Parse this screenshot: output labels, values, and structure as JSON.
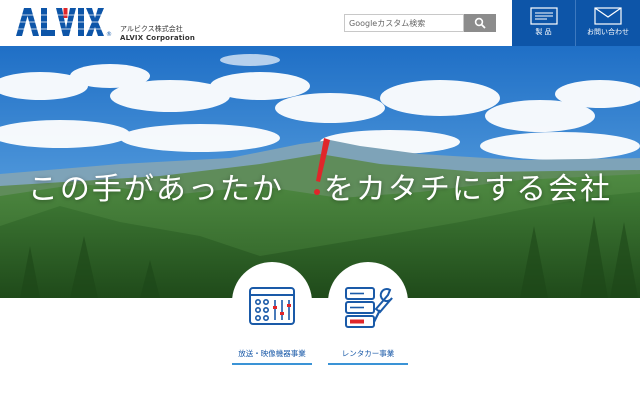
{
  "header": {
    "logo_text": "ALVIX",
    "company_name_ja": "アルビクス株式会社",
    "company_name_en": "ALVIX Corporation",
    "search": {
      "placeholder": "Googleカスタム検索"
    },
    "nav": {
      "products_label": "製 品",
      "contact_label": "お問い合わせ"
    }
  },
  "hero": {
    "tagline_before": "この手があったか",
    "tagline_after": "をカタチにする会社"
  },
  "businesses": [
    {
      "label": "放送・映像機器事業"
    },
    {
      "label": "レンタカー事業"
    }
  ],
  "colors": {
    "brand_blue": "#0d55a8",
    "accent_red": "#e0262a",
    "link_blue": "#1a5aa8"
  }
}
